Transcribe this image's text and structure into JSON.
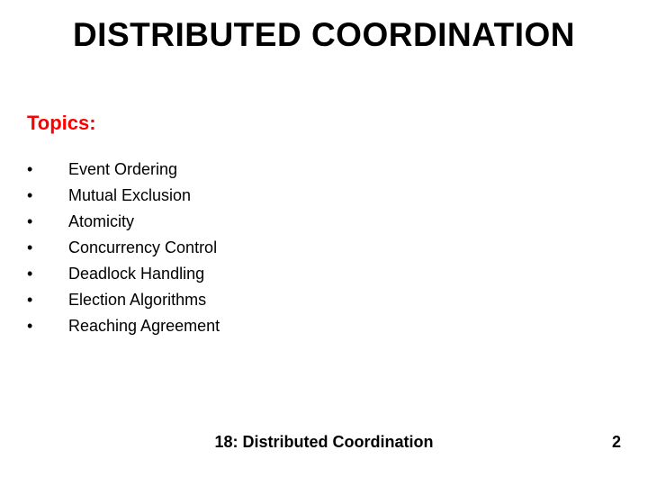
{
  "title": "DISTRIBUTED COORDINATION",
  "topics_label": "Topics:",
  "topics": [
    "Event Ordering",
    "Mutual Exclusion",
    "Atomicity",
    "Concurrency Control",
    "Deadlock Handling",
    "Election Algorithms",
    "Reaching Agreement"
  ],
  "footer": {
    "center": "18: Distributed Coordination",
    "page": "2"
  }
}
